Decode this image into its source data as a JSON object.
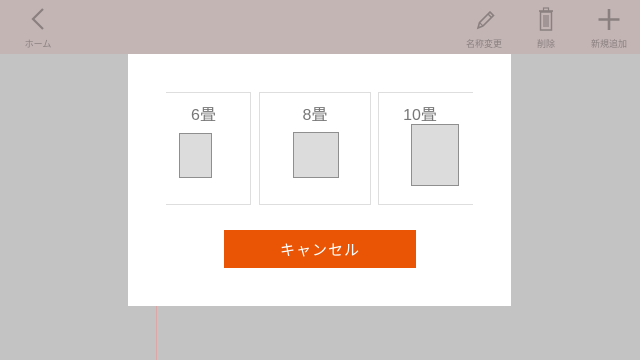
{
  "toolbar": {
    "home_label": "ホーム",
    "rename_label": "名称変更",
    "delete_label": "削除",
    "add_label": "新規追加",
    "icon_color": "#8a8080",
    "background": "#c4b5b5"
  },
  "modal": {
    "room_sizes": [
      {
        "label": "6畳"
      },
      {
        "label": "8畳"
      },
      {
        "label": "10畳"
      }
    ],
    "cancel_label": "キャンセル",
    "accent": "#ea5505"
  }
}
